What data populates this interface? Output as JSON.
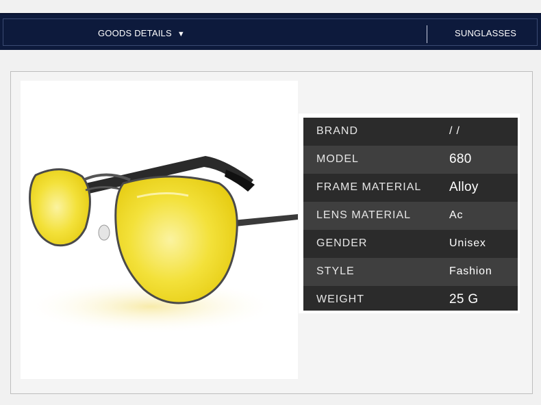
{
  "header": {
    "goods_details_label": "GOODS DETAILS",
    "dropdown_arrow": "▼",
    "category_label": "SUNGLASSES"
  },
  "product_image": {
    "description_icon": "aviator-sunglasses-yellow-lens"
  },
  "specs": [
    {
      "label": "BRAND",
      "value": "/ /"
    },
    {
      "label": "MODEL",
      "value": "680"
    },
    {
      "label": "FRAME MATERIAL",
      "value": "Alloy"
    },
    {
      "label": "LENS MATERIAL",
      "value": "Ac"
    },
    {
      "label": "GENDER",
      "value": "Unisex"
    },
    {
      "label": "STYLE",
      "value": "Fashion"
    },
    {
      "label": "WEIGHT",
      "value": "25 G"
    }
  ],
  "colors": {
    "header_bg": "#0d1a3c",
    "spec_bg_dark": "#2b2b2b",
    "spec_bg_light": "#3f3f3f",
    "lens_yellow": "#f3e13a"
  }
}
